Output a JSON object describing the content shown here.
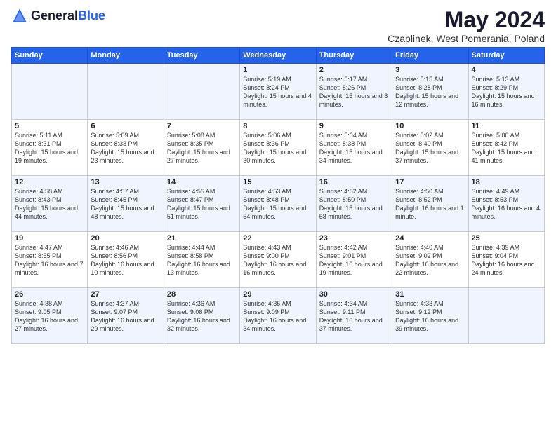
{
  "header": {
    "logo_general": "General",
    "logo_blue": "Blue",
    "title": "May 2024",
    "subtitle": "Czaplinek, West Pomerania, Poland"
  },
  "columns": [
    "Sunday",
    "Monday",
    "Tuesday",
    "Wednesday",
    "Thursday",
    "Friday",
    "Saturday"
  ],
  "weeks": [
    [
      {
        "day": "",
        "info": ""
      },
      {
        "day": "",
        "info": ""
      },
      {
        "day": "",
        "info": ""
      },
      {
        "day": "1",
        "info": "Sunrise: 5:19 AM\nSunset: 8:24 PM\nDaylight: 15 hours and 4 minutes."
      },
      {
        "day": "2",
        "info": "Sunrise: 5:17 AM\nSunset: 8:26 PM\nDaylight: 15 hours and 8 minutes."
      },
      {
        "day": "3",
        "info": "Sunrise: 5:15 AM\nSunset: 8:28 PM\nDaylight: 15 hours and 12 minutes."
      },
      {
        "day": "4",
        "info": "Sunrise: 5:13 AM\nSunset: 8:29 PM\nDaylight: 15 hours and 16 minutes."
      }
    ],
    [
      {
        "day": "5",
        "info": "Sunrise: 5:11 AM\nSunset: 8:31 PM\nDaylight: 15 hours and 19 minutes."
      },
      {
        "day": "6",
        "info": "Sunrise: 5:09 AM\nSunset: 8:33 PM\nDaylight: 15 hours and 23 minutes."
      },
      {
        "day": "7",
        "info": "Sunrise: 5:08 AM\nSunset: 8:35 PM\nDaylight: 15 hours and 27 minutes."
      },
      {
        "day": "8",
        "info": "Sunrise: 5:06 AM\nSunset: 8:36 PM\nDaylight: 15 hours and 30 minutes."
      },
      {
        "day": "9",
        "info": "Sunrise: 5:04 AM\nSunset: 8:38 PM\nDaylight: 15 hours and 34 minutes."
      },
      {
        "day": "10",
        "info": "Sunrise: 5:02 AM\nSunset: 8:40 PM\nDaylight: 15 hours and 37 minutes."
      },
      {
        "day": "11",
        "info": "Sunrise: 5:00 AM\nSunset: 8:42 PM\nDaylight: 15 hours and 41 minutes."
      }
    ],
    [
      {
        "day": "12",
        "info": "Sunrise: 4:58 AM\nSunset: 8:43 PM\nDaylight: 15 hours and 44 minutes."
      },
      {
        "day": "13",
        "info": "Sunrise: 4:57 AM\nSunset: 8:45 PM\nDaylight: 15 hours and 48 minutes."
      },
      {
        "day": "14",
        "info": "Sunrise: 4:55 AM\nSunset: 8:47 PM\nDaylight: 15 hours and 51 minutes."
      },
      {
        "day": "15",
        "info": "Sunrise: 4:53 AM\nSunset: 8:48 PM\nDaylight: 15 hours and 54 minutes."
      },
      {
        "day": "16",
        "info": "Sunrise: 4:52 AM\nSunset: 8:50 PM\nDaylight: 15 hours and 58 minutes."
      },
      {
        "day": "17",
        "info": "Sunrise: 4:50 AM\nSunset: 8:52 PM\nDaylight: 16 hours and 1 minute."
      },
      {
        "day": "18",
        "info": "Sunrise: 4:49 AM\nSunset: 8:53 PM\nDaylight: 16 hours and 4 minutes."
      }
    ],
    [
      {
        "day": "19",
        "info": "Sunrise: 4:47 AM\nSunset: 8:55 PM\nDaylight: 16 hours and 7 minutes."
      },
      {
        "day": "20",
        "info": "Sunrise: 4:46 AM\nSunset: 8:56 PM\nDaylight: 16 hours and 10 minutes."
      },
      {
        "day": "21",
        "info": "Sunrise: 4:44 AM\nSunset: 8:58 PM\nDaylight: 16 hours and 13 minutes."
      },
      {
        "day": "22",
        "info": "Sunrise: 4:43 AM\nSunset: 9:00 PM\nDaylight: 16 hours and 16 minutes."
      },
      {
        "day": "23",
        "info": "Sunrise: 4:42 AM\nSunset: 9:01 PM\nDaylight: 16 hours and 19 minutes."
      },
      {
        "day": "24",
        "info": "Sunrise: 4:40 AM\nSunset: 9:02 PM\nDaylight: 16 hours and 22 minutes."
      },
      {
        "day": "25",
        "info": "Sunrise: 4:39 AM\nSunset: 9:04 PM\nDaylight: 16 hours and 24 minutes."
      }
    ],
    [
      {
        "day": "26",
        "info": "Sunrise: 4:38 AM\nSunset: 9:05 PM\nDaylight: 16 hours and 27 minutes."
      },
      {
        "day": "27",
        "info": "Sunrise: 4:37 AM\nSunset: 9:07 PM\nDaylight: 16 hours and 29 minutes."
      },
      {
        "day": "28",
        "info": "Sunrise: 4:36 AM\nSunset: 9:08 PM\nDaylight: 16 hours and 32 minutes."
      },
      {
        "day": "29",
        "info": "Sunrise: 4:35 AM\nSunset: 9:09 PM\nDaylight: 16 hours and 34 minutes."
      },
      {
        "day": "30",
        "info": "Sunrise: 4:34 AM\nSunset: 9:11 PM\nDaylight: 16 hours and 37 minutes."
      },
      {
        "day": "31",
        "info": "Sunrise: 4:33 AM\nSunset: 9:12 PM\nDaylight: 16 hours and 39 minutes."
      },
      {
        "day": "",
        "info": ""
      }
    ]
  ]
}
